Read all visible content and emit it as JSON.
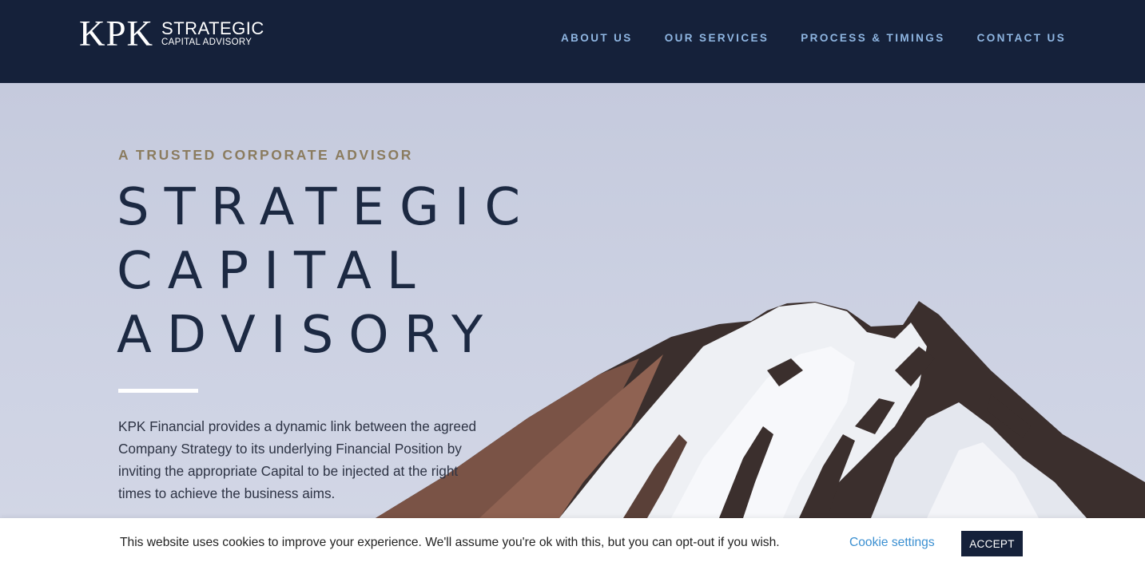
{
  "brand": {
    "mark": "KPK",
    "line1": "STRATEGIC",
    "line2": "CAPITAL ADVISORY"
  },
  "nav": {
    "items": [
      {
        "label": "ABOUT US"
      },
      {
        "label": "OUR SERVICES"
      },
      {
        "label": "PROCESS & TIMINGS"
      },
      {
        "label": "CONTACT US"
      }
    ]
  },
  "hero": {
    "eyebrow": "A TRUSTED CORPORATE ADVISOR",
    "headline": [
      "STRATEGIC",
      "CAPITAL",
      "ADVISORY"
    ],
    "description": "KPK Financial provides a dynamic link between the agreed Company Strategy to its underlying Financial Position by inviting the appropriate Capital to be injected at the right times to achieve the business aims."
  },
  "cookie": {
    "message": "This website uses cookies to improve your experience. We'll assume you're ok with this, but you can opt-out if you wish.",
    "settings_label": "Cookie settings",
    "accept_label": "ACCEPT"
  },
  "colors": {
    "navy": "#15213a",
    "nav_link": "#8fb6e2",
    "eyebrow": "#8b7c5f",
    "headline": "#1c2942",
    "link": "#3a8fd1"
  }
}
